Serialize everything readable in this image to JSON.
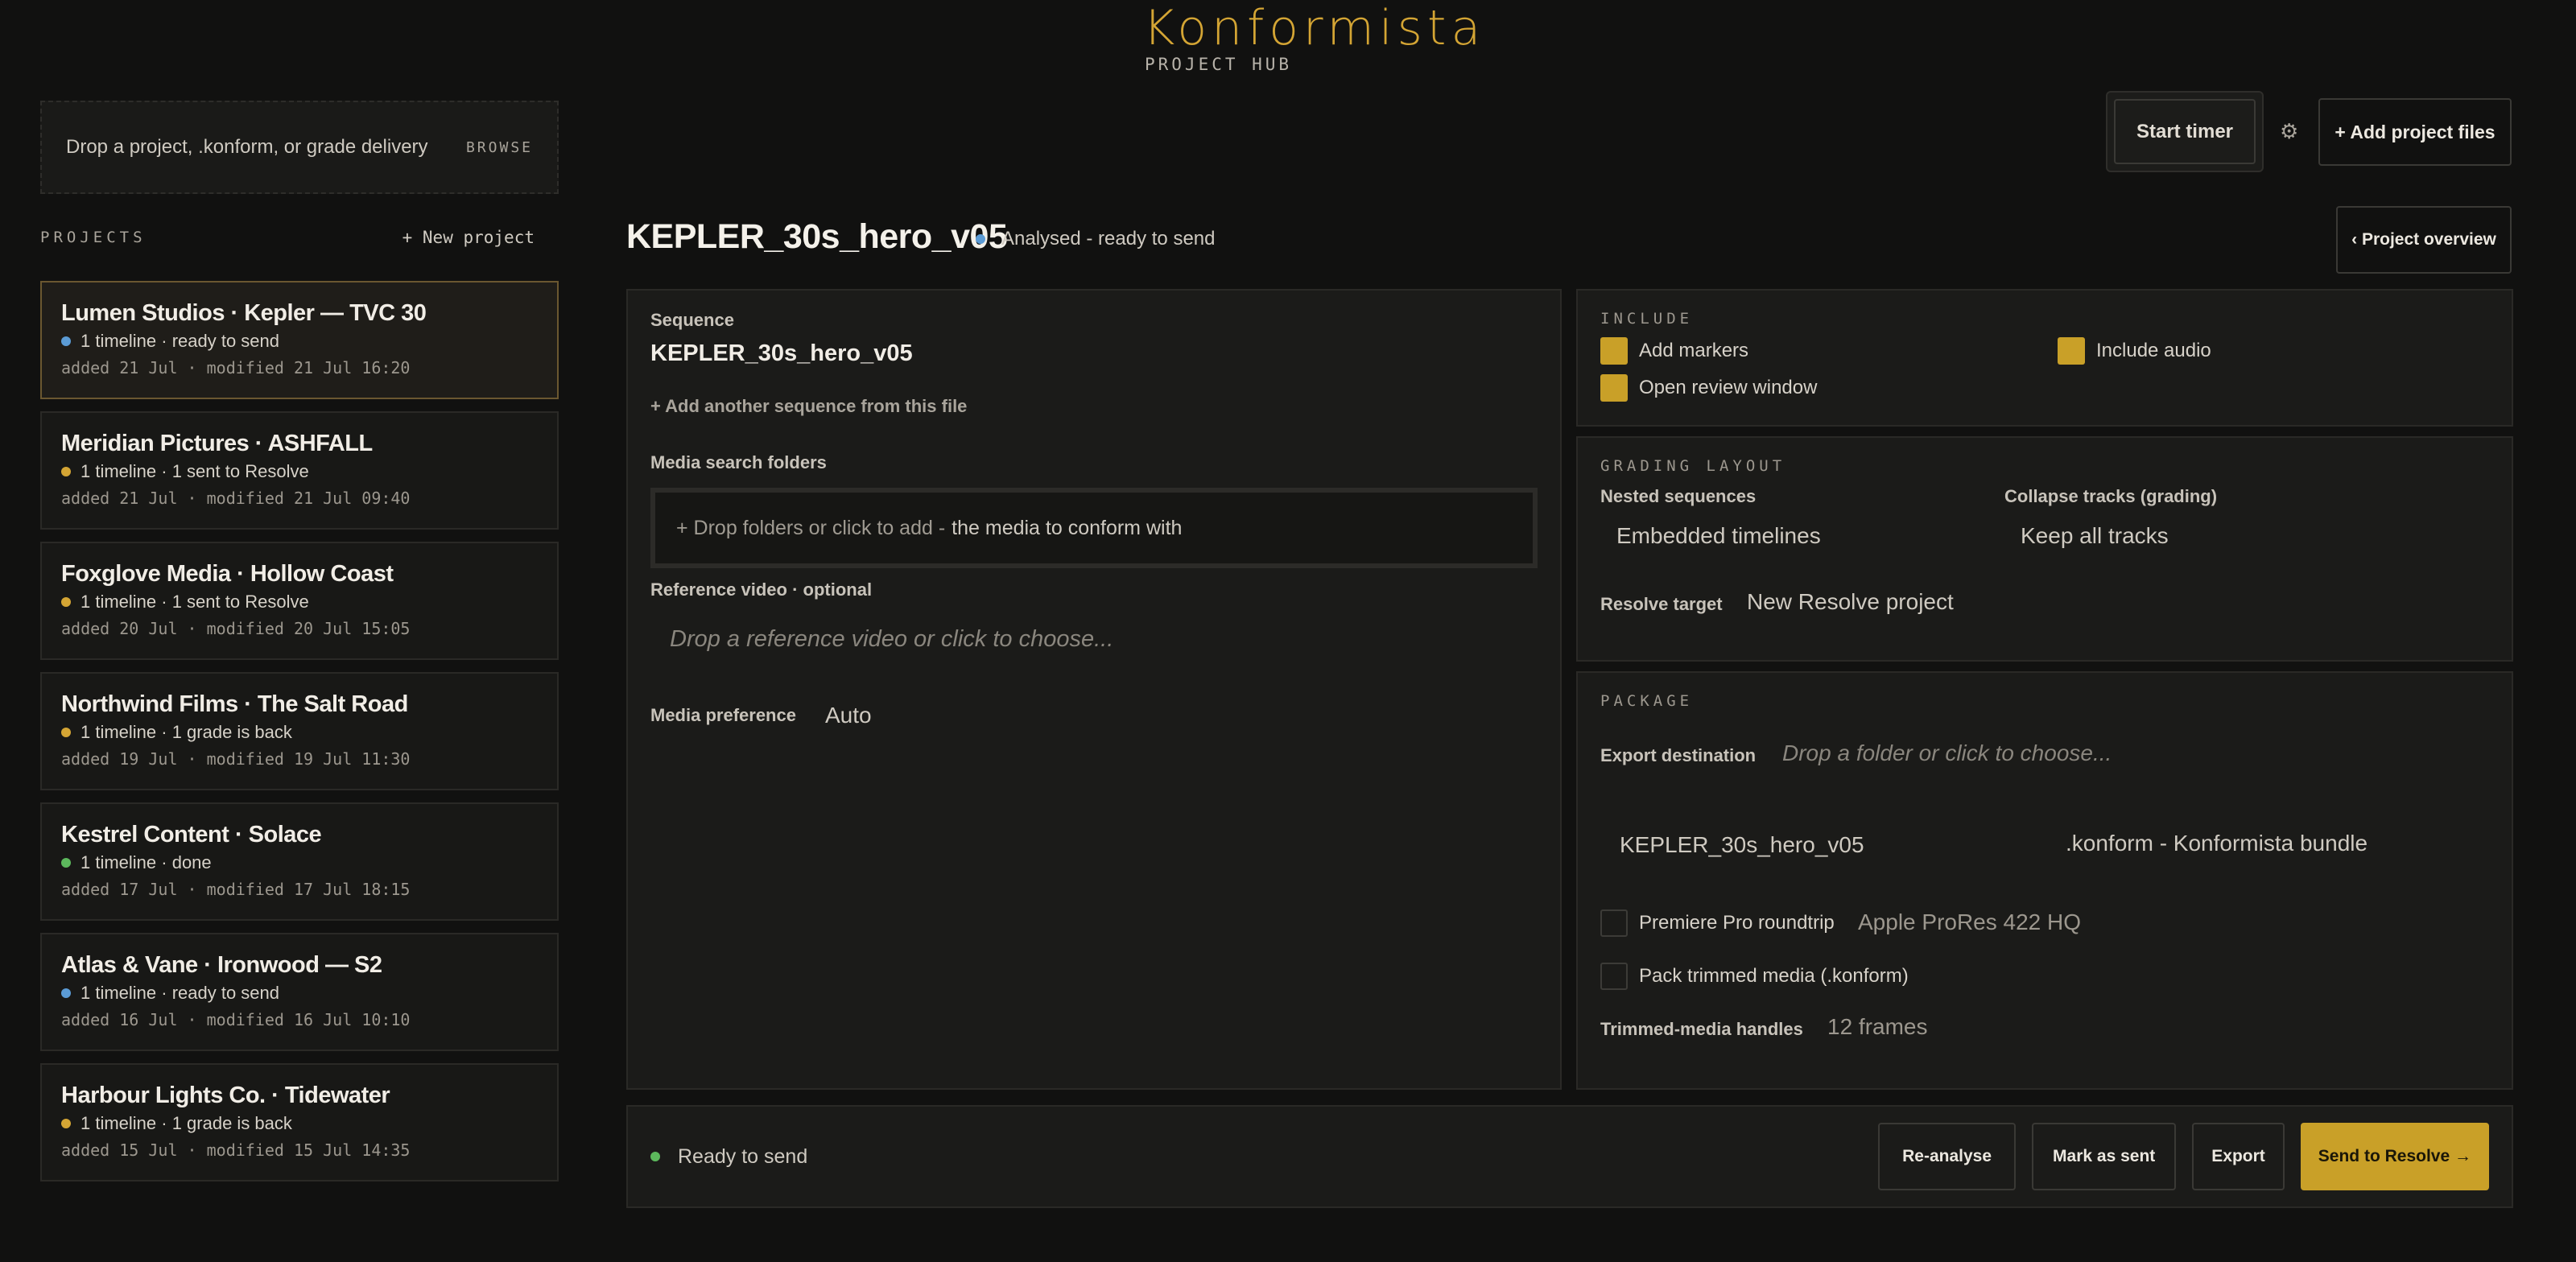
{
  "brand": {
    "title": "Konformista",
    "subtitle": "PROJECT HUB"
  },
  "dropzone": {
    "text": "Drop a project, .konform, or grade delivery",
    "browse": "BROWSE"
  },
  "projects": {
    "label": "PROJECTS",
    "new_label": "+ New project",
    "items": [
      {
        "name": "Lumen Studios · Kepler — TVC 30",
        "status": "1 timeline  ·  ready to send",
        "meta": "added 21 Jul  ·  modified 21 Jul 16:20",
        "dot": "#5b9bd5",
        "active": true
      },
      {
        "name": "Meridian Pictures · ASHFALL",
        "status": "1 timeline  ·  1 sent to Resolve",
        "meta": "added 21 Jul  ·  modified 21 Jul 09:40",
        "dot": "#d4a534"
      },
      {
        "name": "Foxglove Media · Hollow Coast",
        "status": "1 timeline  ·  1 sent to Resolve",
        "meta": "added 20 Jul  ·  modified 20 Jul 15:05",
        "dot": "#d4a534"
      },
      {
        "name": "Northwind Films · The Salt Road",
        "status": "1 timeline  ·  1 grade is back",
        "meta": "added 19 Jul  ·  modified 19 Jul 11:30",
        "dot": "#d4a534"
      },
      {
        "name": "Kestrel Content · Solace",
        "status": "1 timeline  ·  done",
        "meta": "added 17 Jul  ·  modified 17 Jul 18:15",
        "dot": "#5cb85c"
      },
      {
        "name": "Atlas & Vane · Ironwood — S2",
        "status": "1 timeline  ·  ready to send",
        "meta": "added 16 Jul  ·  modified 16 Jul 10:10",
        "dot": "#5b9bd5"
      },
      {
        "name": "Harbour Lights Co. · Tidewater",
        "status": "1 timeline  ·  1 grade is back",
        "meta": "added 15 Jul  ·  modified 15 Jul 14:35",
        "dot": "#d4a534"
      }
    ]
  },
  "toolbar": {
    "start_timer": "Start timer",
    "gear_icon": "gear-icon",
    "add_files": "+ Add project files",
    "overview": "‹ Project overview"
  },
  "sequence": {
    "title": "KEPLER_30s_hero_v05",
    "status": "Analysed - ready to send",
    "status_color": "#5b9bd5",
    "sequence_label": "Sequence",
    "sequence_name": "KEPLER_30s_hero_v05",
    "add_sequence": "+ Add another sequence from this file",
    "media_folders_label": "Media search folders",
    "media_drop_a": "+ Drop folders or click to add - ",
    "media_drop_b": "the media to conform with",
    "reference_label": "Reference video · optional",
    "reference_placeholder": "Drop a reference video or click to choose...",
    "media_pref_label": "Media preference",
    "media_pref_value": "Auto"
  },
  "include": {
    "label": "INCLUDE",
    "add_markers": "Add markers",
    "include_audio": "Include audio",
    "open_review": "Open review window"
  },
  "grading": {
    "label": "GRADING LAYOUT",
    "nested_label": "Nested sequences",
    "nested_value": "Embedded timelines",
    "collapse_label": "Collapse tracks (grading)",
    "collapse_value": "Keep all tracks",
    "target_label": "Resolve target",
    "target_value": "New Resolve project"
  },
  "package": {
    "label": "PACKAGE",
    "export_label": "Export destination",
    "export_placeholder": "Drop a folder or click to choose...",
    "name_value": "KEPLER_30s_hero_v05",
    "format_value": ".konform - Konformista bundle",
    "roundtrip_label": "Premiere Pro roundtrip",
    "codec_value": "Apple ProRes 422 HQ",
    "pack_label": "Pack trimmed media (.konform)",
    "handles_label": "Trimmed-media handles",
    "handles_value": "12 frames"
  },
  "footer": {
    "status": "Ready to send",
    "status_color": "#5cb85c",
    "reanalyse": "Re-analyse",
    "mark_sent": "Mark as sent",
    "export": "Export",
    "send": "Send to Resolve →"
  },
  "colors": {
    "accent": "#d4a534",
    "button_primary": "#c9a028",
    "background": "#111110"
  }
}
